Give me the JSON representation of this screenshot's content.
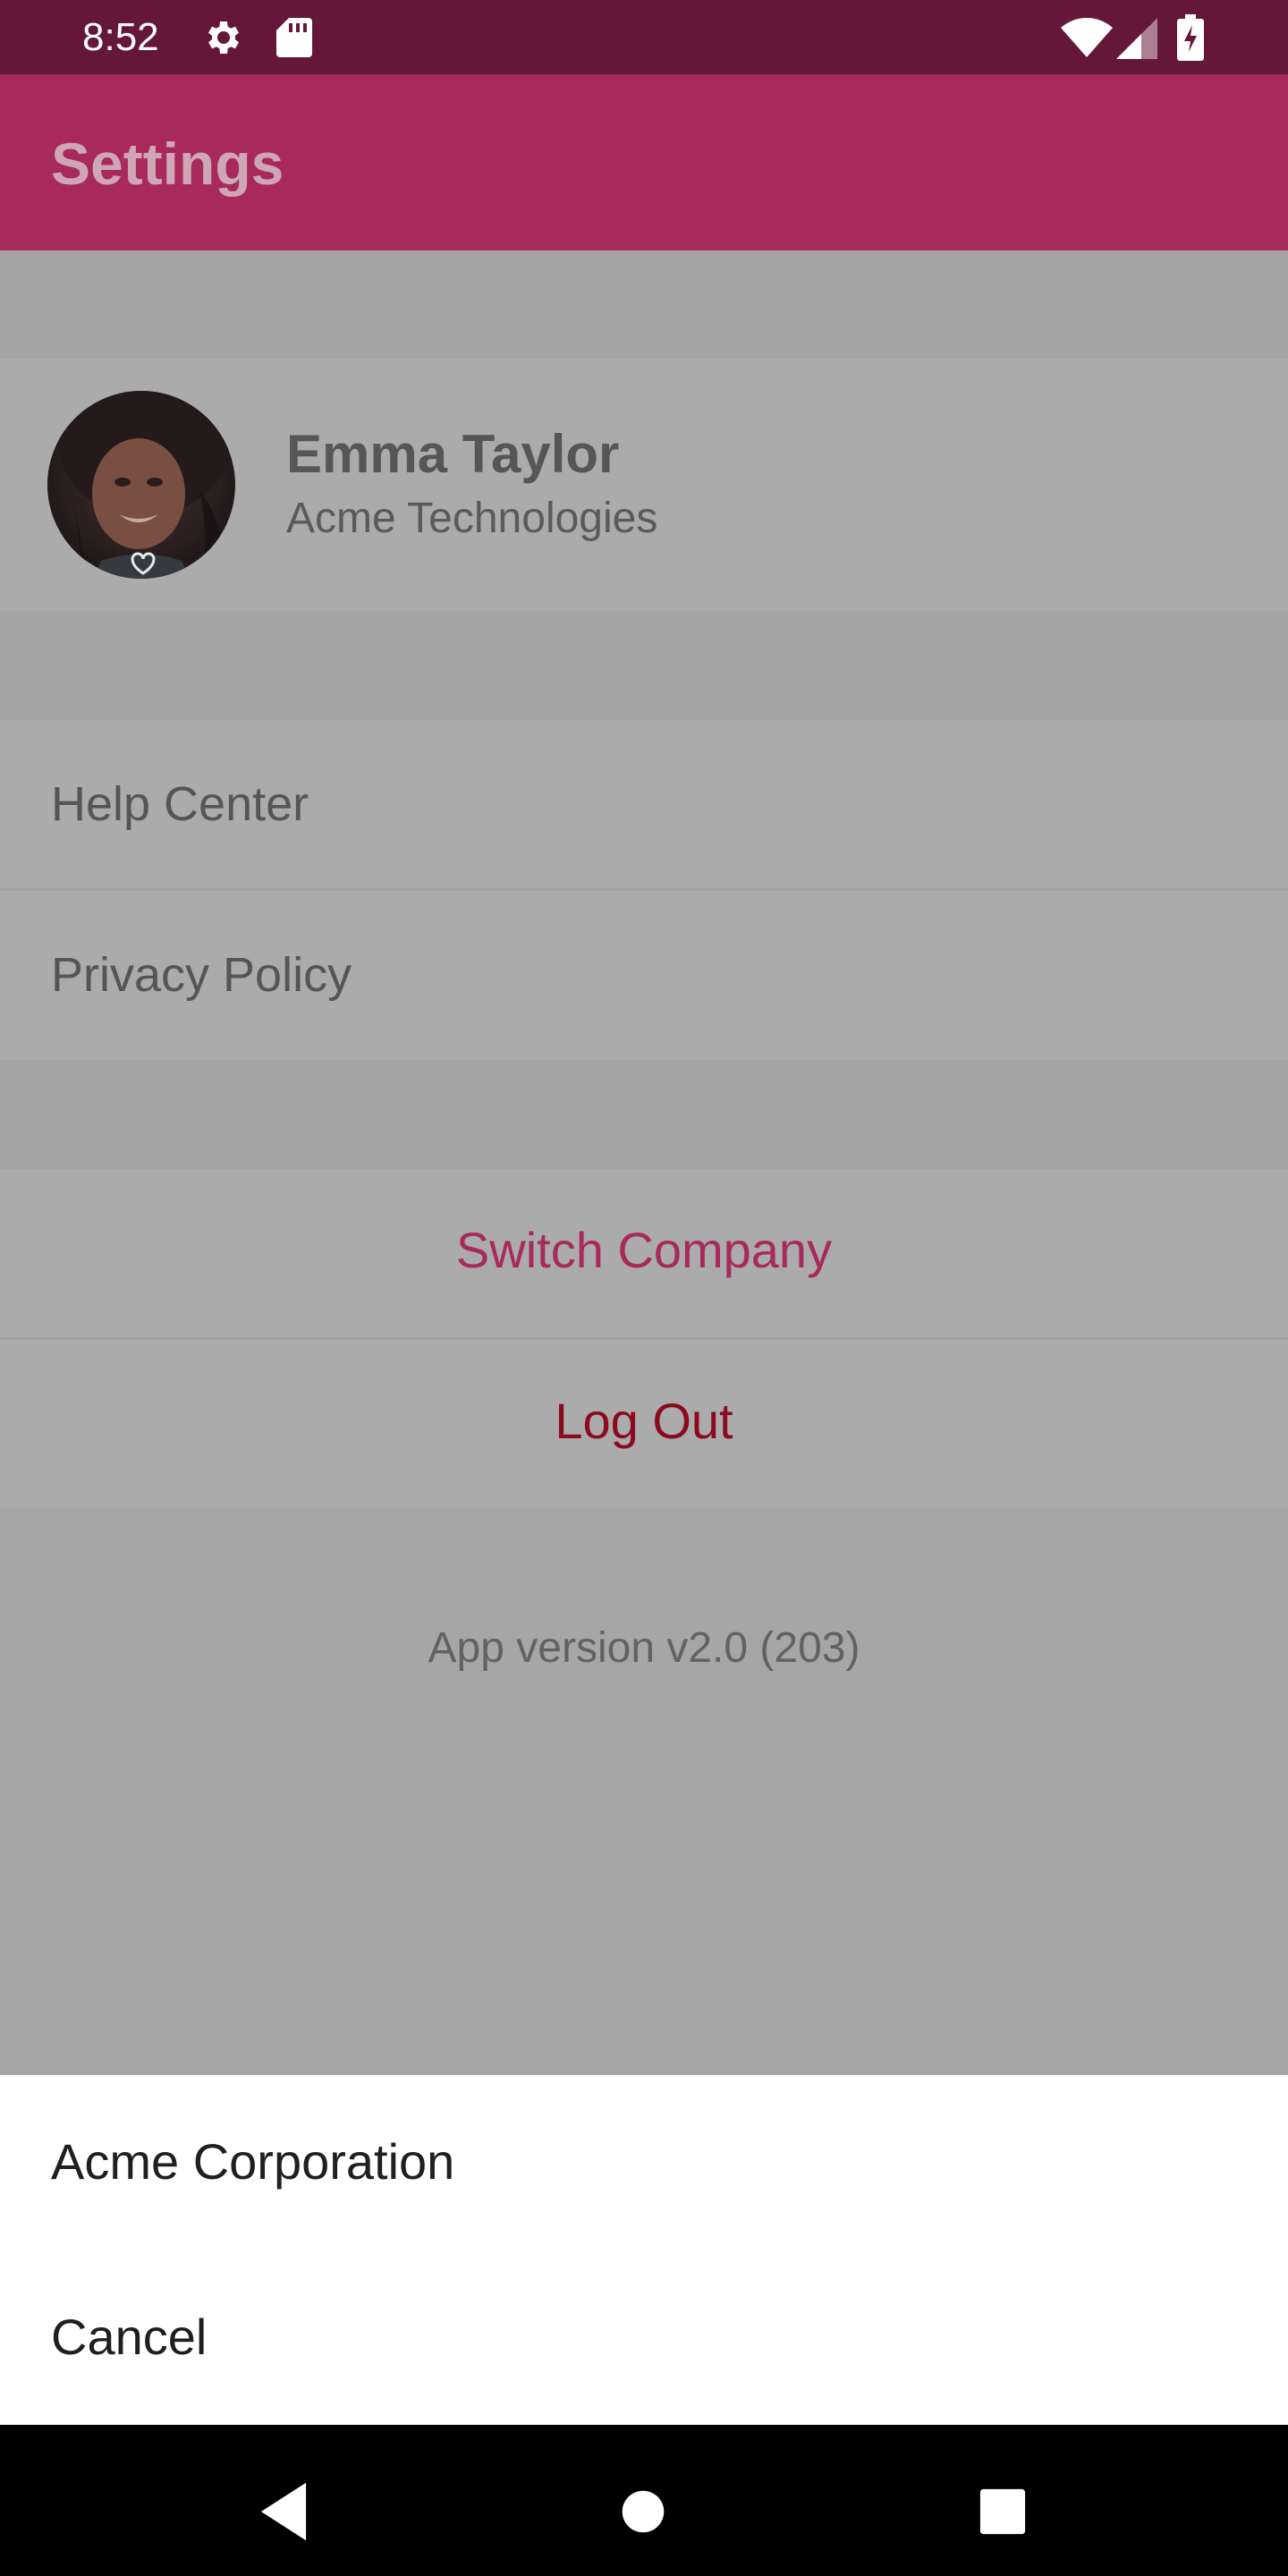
{
  "status_bar": {
    "time": "8:52",
    "icons": [
      "gear-icon",
      "sd-card-icon",
      "wifi-icon",
      "signal-icon",
      "battery-charging-icon"
    ]
  },
  "app_bar": {
    "title": "Settings"
  },
  "profile": {
    "name": "Emma Taylor",
    "company": "Acme Technologies"
  },
  "menu": {
    "items": [
      {
        "label": "Help Center"
      },
      {
        "label": "Privacy Policy"
      }
    ]
  },
  "actions": {
    "switch_company": "Switch Company",
    "log_out": "Log Out"
  },
  "footer": {
    "version": "App version v2.0 (203)"
  },
  "bottom_sheet": {
    "options": [
      {
        "label": "Acme Corporation"
      },
      {
        "label": "Cancel"
      }
    ]
  },
  "colors": {
    "status_bar": "#65173a",
    "app_bar": "#a8295b",
    "switch_company": "#a8295b",
    "log_out": "#8b0a1e"
  },
  "nav_bar": {
    "icons": [
      "back-icon",
      "home-icon",
      "recents-icon"
    ]
  }
}
